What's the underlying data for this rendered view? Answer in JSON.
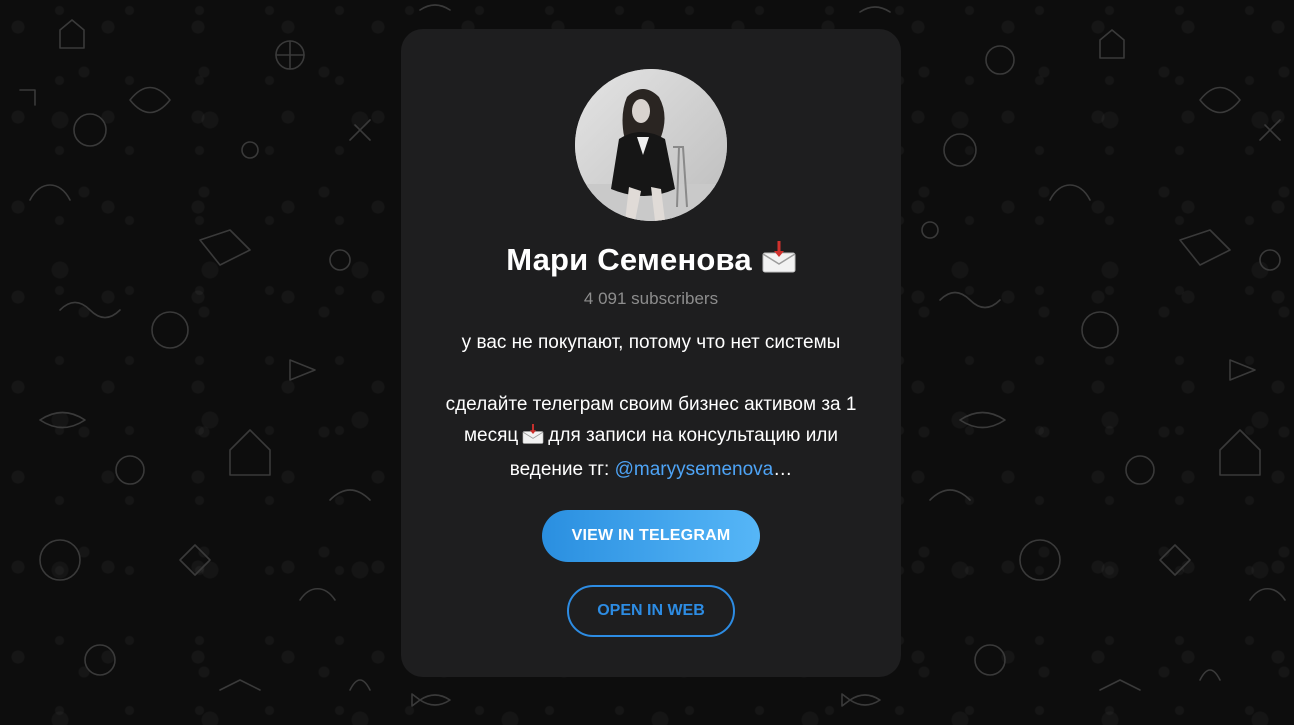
{
  "channel": {
    "name": "Мари Семенова",
    "name_emoji": "envelope-with-arrow-icon",
    "subscribers": "4 091 subscribers",
    "description_line1": "у вас не покупают, потому что нет системы",
    "description_line2a": "сделайте телеграм своим бизнес активом за 1",
    "description_line2b_before": "месяц",
    "description_line2b_after": "для записи на консультацию или",
    "description_line3_prefix": "ведение тг: ",
    "description_link": "@maryysemenova",
    "description_ellipsis": "…"
  },
  "buttons": {
    "view_in_telegram": "VIEW IN TELEGRAM",
    "open_in_web": "OPEN IN WEB"
  },
  "colors": {
    "background": "#0d0d0d",
    "card": "#1e1e1f",
    "accent": "#2d8ce3",
    "link": "#4ea4f6",
    "muted_text": "#8d8d8d"
  }
}
